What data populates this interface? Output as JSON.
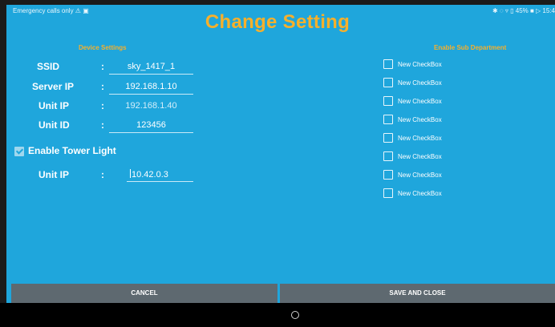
{
  "status": {
    "left": "Emergency calls only ⚠ ▣",
    "right": "✱ ◌ ▿ ▯ 45% ■ ▷ 15:4"
  },
  "title": "Change Setting",
  "device": {
    "heading": "Device Settings",
    "ssid_label": "SSID",
    "ssid_value": "sky_1417_1",
    "server_ip_label": "Server IP",
    "server_ip_value": "192.168.1.10",
    "unit_ip_label": "Unit IP",
    "unit_ip_value": "192.168.1.40",
    "unit_id_label": "Unit ID",
    "unit_id_value": "123456",
    "separator": ":",
    "tower_light_label": "Enable Tower Light",
    "tower_light_checked": true,
    "tower_unit_ip_label": "Unit IP",
    "tower_unit_ip_value": "10.42.0.3"
  },
  "sub_department": {
    "heading": "Enable Sub Department",
    "checkboxes": [
      {
        "label": "New CheckBox",
        "checked": false
      },
      {
        "label": "New CheckBox",
        "checked": false
      },
      {
        "label": "New CheckBox",
        "checked": false
      },
      {
        "label": "New CheckBox",
        "checked": false
      },
      {
        "label": "New CheckBox",
        "checked": false
      },
      {
        "label": "New CheckBox",
        "checked": false
      },
      {
        "label": "New CheckBox",
        "checked": false
      },
      {
        "label": "New CheckBox",
        "checked": false
      }
    ]
  },
  "buttons": {
    "cancel": "CANCEL",
    "save_and_close": "SAVE AND CLOSE"
  },
  "colors": {
    "background": "#1fa6dc",
    "accent": "#f7b02b",
    "button": "#5e6970"
  }
}
